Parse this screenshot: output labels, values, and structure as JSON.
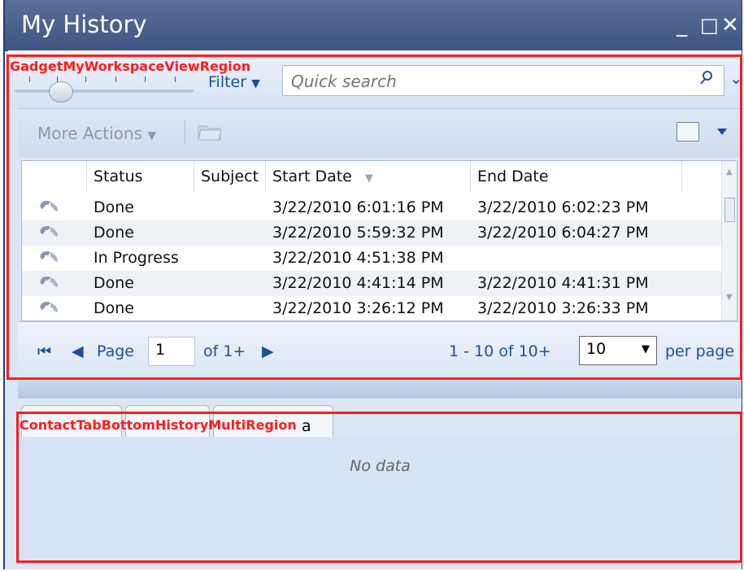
{
  "window": {
    "title": "My History",
    "minimize_glyph": "_",
    "maximize_glyph": "□",
    "close_glyph": "✕"
  },
  "search": {
    "filter_label": "Filter",
    "placeholder": "Quick search",
    "value": ""
  },
  "actions": {
    "more_actions_label": "More Actions"
  },
  "grid": {
    "columns": [
      "Status",
      "Subject",
      "Start Date",
      "End Date"
    ],
    "rows": [
      {
        "status": "Done",
        "subject": "",
        "start": "3/22/2010 6:01:16 PM",
        "end": "3/22/2010 6:02:23 PM"
      },
      {
        "status": "Done",
        "subject": "",
        "start": "3/22/2010 5:59:32 PM",
        "end": "3/22/2010 6:04:27 PM"
      },
      {
        "status": "In Progress",
        "subject": "",
        "start": "3/22/2010 4:51:38 PM",
        "end": ""
      },
      {
        "status": "Done",
        "subject": "",
        "start": "3/22/2010 4:41:14 PM",
        "end": "3/22/2010 4:41:31 PM"
      },
      {
        "status": "Done",
        "subject": "",
        "start": "3/22/2010 3:26:12 PM",
        "end": "3/22/2010 3:26:33 PM"
      }
    ]
  },
  "pager": {
    "page_label": "Page",
    "page_value": "1",
    "of_label": "of 1+",
    "range_label": "1 - 10 of 10+",
    "page_size": "10",
    "per_page_label": "per page"
  },
  "bottom": {
    "no_data": "No data",
    "tab_partial": "a"
  },
  "annotations": {
    "top_region": "GadgetMyWorkspaceViewRegion",
    "bottom_region": "ContactTabBottomHistoryMultiRegion"
  },
  "colors": {
    "accent": "#1f4f98",
    "title_bg": "#3f5582",
    "annotation": "#ff1b1b"
  }
}
